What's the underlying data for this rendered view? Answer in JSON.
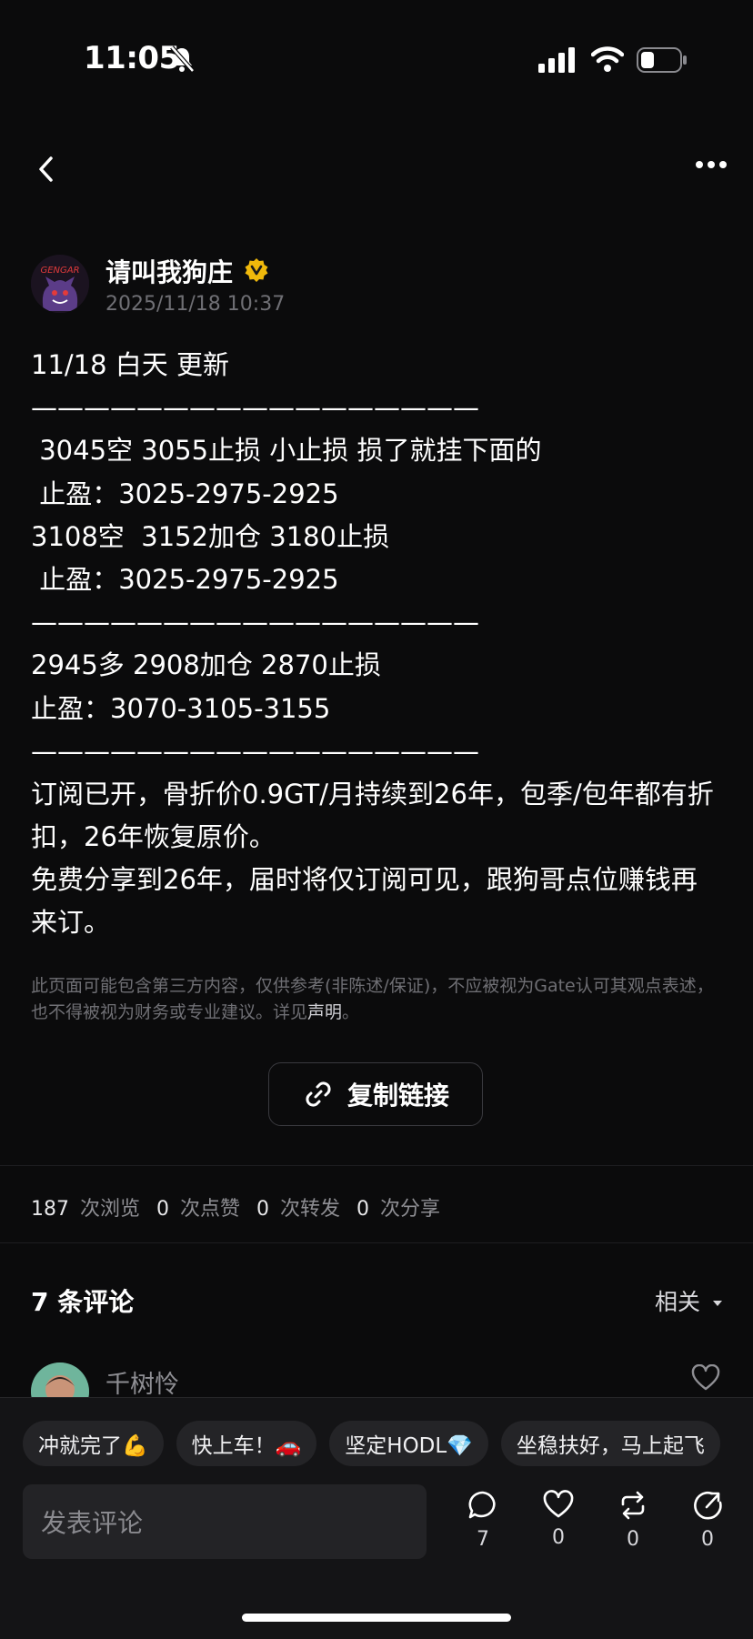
{
  "status_bar": {
    "time": "11:05"
  },
  "author": {
    "name": "请叫我狗庄",
    "post_time": "2025/11/18 10:37",
    "avatar_text": "GENGAR"
  },
  "post": {
    "lines": [
      "11/18 白天 更新",
      "—————————————————",
      " 3045空 3055止损 小止损 损了就挂下面的",
      " 止盈：3025-2975-2925",
      "3108空  3152加仓 3180止损",
      " 止盈：3025-2975-2925",
      "—————————————————",
      "2945多 2908加仓 2870止损",
      "止盈：3070-3105-3155",
      "—————————————————"
    ],
    "paragraph1": "订阅已开，骨折价0.9GT/月持续到26年，包季/包年都有折扣，26年恢复原价。",
    "paragraph2": "免费分享到26年，届时将仅订阅可见，跟狗哥点位赚钱再来订。"
  },
  "disclaimer": {
    "text": "此页面可能包含第三方内容，仅供参考(非陈述/保证)，不应被视为Gate认可其观点表述，也不得被视为财务或专业建议。详见",
    "link": "声明",
    "end": "。"
  },
  "copy_link_label": "复制链接",
  "stats": [
    {
      "num": "187",
      "label": "次浏览"
    },
    {
      "num": "0",
      "label": "次点赞"
    },
    {
      "num": "0",
      "label": "次转发"
    },
    {
      "num": "0",
      "label": "次分享"
    }
  ],
  "comments": {
    "title": "7 条评论",
    "sort": "相关",
    "first_commenter": "千树怜"
  },
  "quick_replies": [
    "冲就完了💪",
    "快上车！🚗",
    "坚定HODL💎",
    "坐稳扶好，马上起飞"
  ],
  "comment_input": {
    "placeholder": "发表评论"
  },
  "actions": {
    "comments": "7",
    "likes": "0",
    "reposts": "0",
    "shares": "0"
  },
  "icons": [
    "bell-slash-icon",
    "signal-icon",
    "wifi-icon",
    "battery-icon",
    "back-icon",
    "more-icon",
    "verified-icon",
    "link-icon",
    "dropdown-icon",
    "heart-icon",
    "comment-icon",
    "repost-icon",
    "share-icon"
  ],
  "colors": {
    "background": "#0b0b0c",
    "muted": "#6f6f74",
    "verified": "#f0b90b"
  }
}
